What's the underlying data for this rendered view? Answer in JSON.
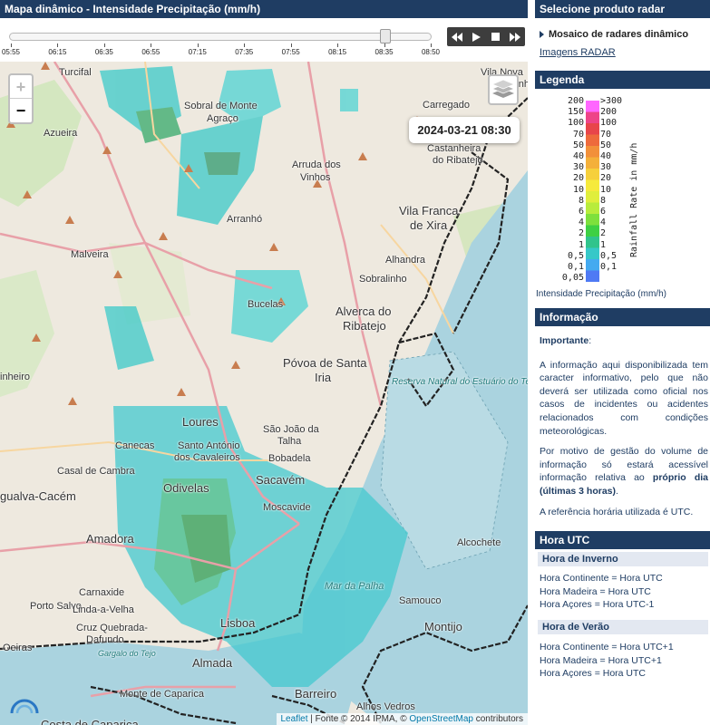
{
  "map_title": "Mapa dinâmico - Intensidade Precipitação (mm/h)",
  "timeline": {
    "ticks": [
      "05:55",
      "06:15",
      "06:35",
      "06:55",
      "07:15",
      "07:35",
      "07:55",
      "08:15",
      "08:35",
      "08:50"
    ],
    "selected_time": "08:30"
  },
  "controls": {
    "rewind": "rewind-icon",
    "play": "play-icon",
    "stop": "stop-icon",
    "forward": "fast-forward-icon"
  },
  "map": {
    "zoom_in": "+",
    "zoom_out": "−",
    "timestamp": "2024-03-21 08:30",
    "places": {
      "turcifal": "Turcifal",
      "sobral": "Sobral de Monte",
      "agraco": "Agraço",
      "vila_nova": "Vila Nova",
      "rainha": "da Rainha",
      "carregado": "Carregado",
      "azueira": "Azueira",
      "castanheira": "Castanheira",
      "ribatejo1": "do Ribatejo",
      "arruda": "Arruda dos",
      "vinhos": "Vinhos",
      "vila_franca": "Vila Franca",
      "de_xira": "de Xira",
      "arranho": "Arranhó",
      "malveira": "Malveira",
      "alhandra": "Alhandra",
      "sobralinho": "Sobralinho",
      "bucelas": "Bucelas",
      "alverca": "Alverca do",
      "ribatejo2": "Ribatejo",
      "povoa": "Póvoa de Santa",
      "iria": "Iria",
      "reserva": "Reserva Natural do Estuário do Tejo",
      "loures": "Loures",
      "santo_antonio": "Santo António",
      "cavaleiros": "dos Cavaleiros",
      "sao_joao": "São João da",
      "talha": "Talha",
      "canecas": "Canecas",
      "bobadela": "Bobadela",
      "casal": "Casal de Cambra",
      "odivelas": "Odivelas",
      "sacavem": "Sacavém",
      "moscavide": "Moscavide",
      "cacem": "gualva-Cacém",
      "amadora": "Amadora",
      "alcochete": "Alcochete",
      "mar_palha": "Mar da Palha",
      "carnaxide": "Carnaxide",
      "samouco": "Samouco",
      "porto_salvo": "Porto Salvo",
      "linda": "Linda-a-Velha",
      "cruz": "Cruz Quebrada-",
      "dafundo": "Dafundo",
      "lisboa": "Lisboa",
      "montijo": "Montijo",
      "oeiras": "Oeiras",
      "gargalo": "Gargalo do Tejo",
      "almada": "Almada",
      "caparica": "Monte de Caparica",
      "barreiro": "Barreiro",
      "alhos": "Alhos Vedros",
      "costa": "Costa de Caparica",
      "inheiro": "inheiro"
    },
    "attribution": {
      "leaflet": "Leaflet",
      "source": " | Fonte © 2014 IPMA, © ",
      "osm": "OpenStreetMap",
      "contributors": " contributors"
    }
  },
  "product": {
    "header": "Selecione produto radar",
    "selected": "Mosaico de radares dinâmico",
    "link": "Imagens RADAR"
  },
  "legend": {
    "header": "Legenda",
    "left_values": [
      "200",
      "150",
      "100",
      "70",
      "50",
      "40",
      "30",
      "20",
      "10",
      "8",
      "6",
      "4",
      "2",
      "1",
      "0,5",
      "0,1",
      "0,05"
    ],
    "right_values": [
      ">300",
      "200",
      "100",
      "70",
      "50",
      "40",
      "30",
      "20",
      "10",
      "8",
      "6",
      "4",
      "2",
      "1",
      "0,5",
      "0,1"
    ],
    "axis_label": "Rainfall Rate in mm/h",
    "caption": "Intensidade Precipitação (mm/h)",
    "colors": [
      "#ff66ff",
      "#ee4488",
      "#e8454a",
      "#ee6a3c",
      "#f2903a",
      "#f4b03a",
      "#f6d03c",
      "#f6ea3c",
      "#e0ee3c",
      "#b8ec3c",
      "#7ee03c",
      "#3ed043",
      "#30c48c",
      "#36c8c8",
      "#44aaf0",
      "#4f7af4"
    ]
  },
  "info": {
    "header": "Informação",
    "important": "Importante",
    "colon": ":",
    "p1": "A informação aqui disponibilizada tem caracter informativo, pelo que não deverá ser utilizada como oficial nos casos de incidentes ou acidentes relacionados com condições meteorológicas.",
    "p2_a": "Por motivo de gestão do volume de informação só estará acessível informação relativa ao ",
    "p2_b": "próprio dia (últimas 3 horas)",
    "p2_c": ".",
    "p3": "A referência horária utilizada é UTC."
  },
  "utc": {
    "header": "Hora UTC",
    "winter_title": "Hora de Inverno",
    "winter": [
      "Hora Continente = Hora UTC",
      "Hora Madeira = Hora UTC",
      "Hora Açores = Hora UTC-1"
    ],
    "summer_title": "Hora de Verão",
    "summer": [
      "Hora Continente = Hora UTC+1",
      "Hora Madeira = Hora UTC+1",
      "Hora Açores = Hora UTC"
    ]
  }
}
